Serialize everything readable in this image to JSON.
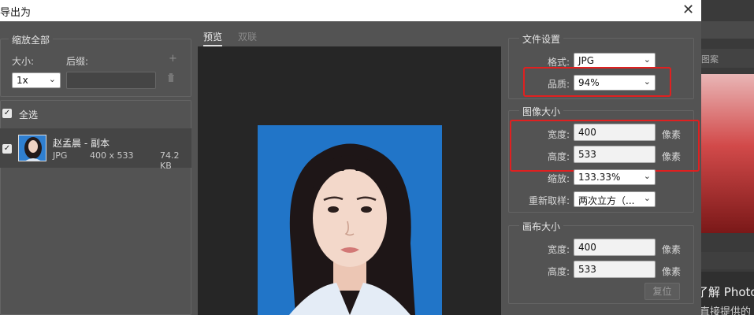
{
  "dialog": {
    "title": "导出为",
    "close_glyph": "✕"
  },
  "left": {
    "scale_all": "缩放全部",
    "size_label": "大小:",
    "suffix_label": "后缀:",
    "size_value": "1x",
    "suffix_value": "",
    "add_glyph": "+",
    "delete_glyph": "🗑",
    "select_all": "全选",
    "check_glyph": "✓",
    "file": {
      "name": "赵孟晨 - 副本",
      "format": "JPG",
      "dimensions": "400 x 533",
      "size": "74.2 KB"
    }
  },
  "preview": {
    "tab_preview": "预览",
    "tab_2up": "双联"
  },
  "settings": {
    "file_settings": "文件设置",
    "format_label": "格式:",
    "format_value": "JPG",
    "quality_label": "品质:",
    "quality_value": "94%",
    "image_size": "图像大小",
    "width_label": "宽度:",
    "width_value": "400",
    "height_label": "高度:",
    "height_value": "533",
    "unit": "像素",
    "scale_label": "缩放:",
    "scale_value": "133.33%",
    "resample_label": "重新取样:",
    "resample_value": "两次立方（...",
    "canvas_size": "画布大小",
    "canvas_width_label": "宽度:",
    "canvas_width_value": "400",
    "canvas_height_label": "高度:",
    "canvas_height_value": "533",
    "reset_button": "复位"
  },
  "background_app": {
    "tab": "图案",
    "text1": "了解 Photos",
    "text2": "直接提供的"
  },
  "colors": {
    "annotation_red": "#e02020",
    "photo_blue": "#2175c8"
  }
}
